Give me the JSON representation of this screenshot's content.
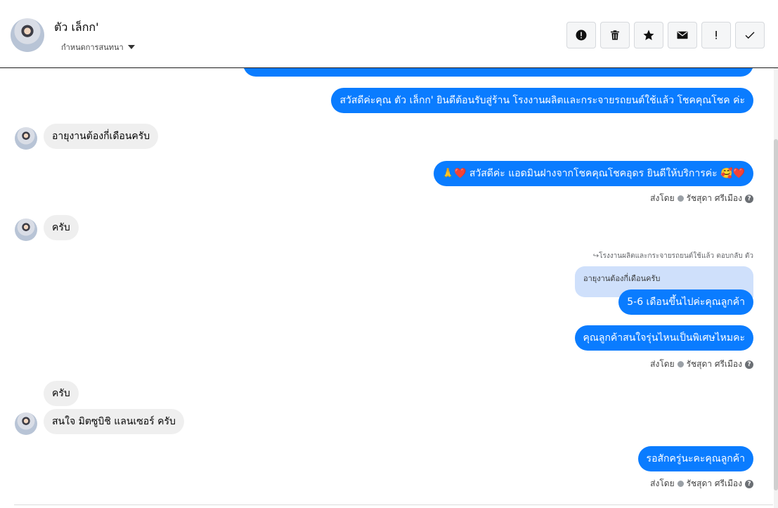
{
  "header": {
    "contact_name": "ตัว เล็กก'",
    "status_label": "กำหนดการสนทนา"
  },
  "actions": [
    {
      "name": "alert-button",
      "icon": "alert-circle-icon"
    },
    {
      "name": "delete-button",
      "icon": "trash-icon"
    },
    {
      "name": "star-button",
      "icon": "star-icon"
    },
    {
      "name": "mail-button",
      "icon": "envelope-icon"
    },
    {
      "name": "important-button",
      "icon": "exclamation-icon"
    },
    {
      "name": "done-button",
      "icon": "check-icon"
    }
  ],
  "messages": {
    "m1": "สวัสดีค่ะคุณ ตัว เล็กก' ยินดีต้อนรับสู่ร้าน โรงงานผลิตและกระจายรถยนต์ใช้แล้ว โชคคุณโชค ค่ะ",
    "m2": "อายุงานต้องกี่เดือนครับ",
    "m3": "🙏❤️ สวัสดีค่ะ แอดมินฝางจากโชคคุณโชคอุดร ยินดีให้บริการค่ะ 🥰❤️",
    "m4": "ครับ",
    "reply_note": "↪โรงงานผลิตและกระจายรถยนต์ใช้แล้ว ตอบกลับ ตัว",
    "quoted": "อายุงานต้องกี่เดือนครับ",
    "m5": "5-6 เดือนขึ้นไปค่ะคุณลูกค้า",
    "m6": "คุณลูกค้าสนใจรุ่นไหนเป็นพิเศษไหมคะ",
    "m7": "ครับ",
    "m8": "สนใจ มิตซูบิชิ แลนเซอร์ ครับ",
    "m9": "รอสักครู่นะคะคุณลูกค้า"
  },
  "sent_by": {
    "prefix": "ส่งโดย",
    "agent": "รัชสุดา ศรีเมือง",
    "help": "?"
  },
  "colors": {
    "outgoing": "#0a7cff",
    "incoming": "#efefef",
    "quoted": "#cfe0fb"
  }
}
